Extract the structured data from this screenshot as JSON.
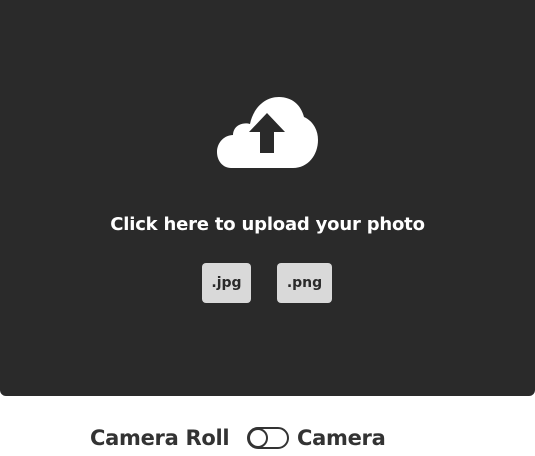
{
  "upload": {
    "icon": "cloud-upload-icon",
    "prompt": "Click here to upload your photo",
    "formats": [
      ".jpg",
      ".png"
    ]
  },
  "mode": {
    "left_label": "Camera Roll",
    "right_label": "Camera",
    "toggle_icon": "toggle-switch-icon"
  },
  "colors": {
    "panel": "#2a2a2a",
    "badge": "#d9d9d9",
    "text_dark": "#333333"
  }
}
